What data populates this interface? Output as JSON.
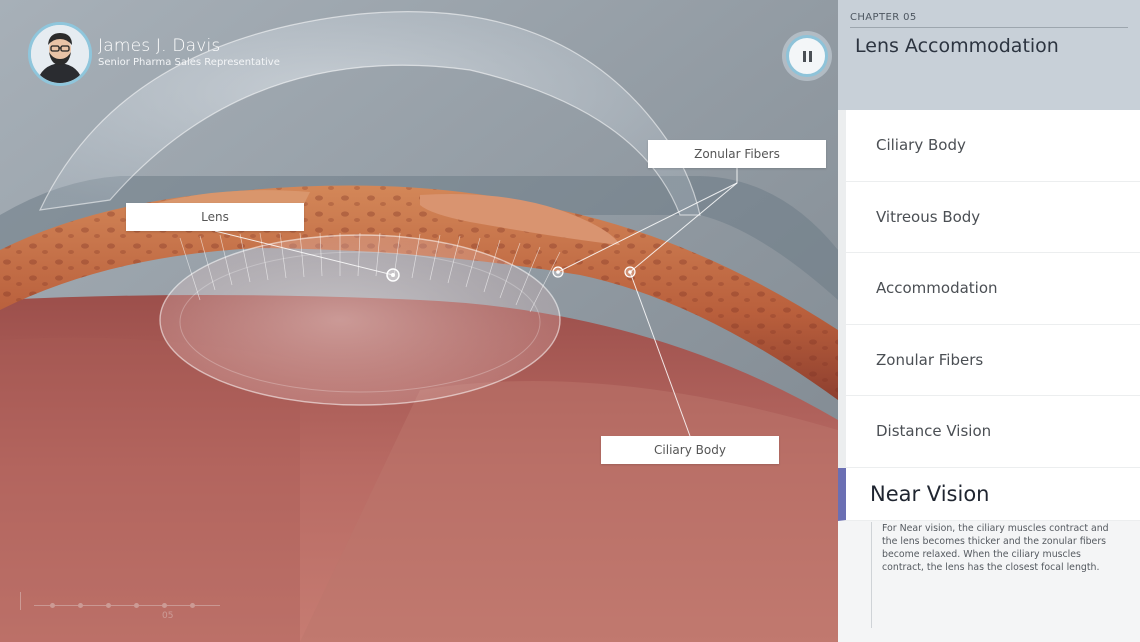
{
  "presenter": {
    "name": "James J. Davis",
    "role": "Senior Pharma Sales Representative",
    "avatar_icon": "person-avatar-icon"
  },
  "player": {
    "pause_icon": "pause-icon"
  },
  "callouts": {
    "lens": "Lens",
    "zonular_fibers": "Zonular Fibers",
    "ciliary_body": "Ciliary Body"
  },
  "timeline": {
    "current": "05"
  },
  "chapter": {
    "label": "CHAPTER 05",
    "title": "Lens Accommodation"
  },
  "topics": [
    {
      "label": "Ciliary Body"
    },
    {
      "label": "Vitreous Body"
    },
    {
      "label": "Accommodation"
    },
    {
      "label": "Zonular Fibers"
    },
    {
      "label": "Distance Vision"
    },
    {
      "label": "Near Vision",
      "active": true
    }
  ],
  "active_topic": {
    "description": "For Near vision, the ciliary muscles contract and the lens becomes thicker and the zonular fibers become relaxed. When the ciliary muscles contract, the lens has the closest focal length."
  },
  "colors": {
    "accent": "#6b6fb3",
    "avatar_ring": "#8fc6dc",
    "header_bg": "#c8d0d8",
    "tissue": "#b36a62"
  }
}
